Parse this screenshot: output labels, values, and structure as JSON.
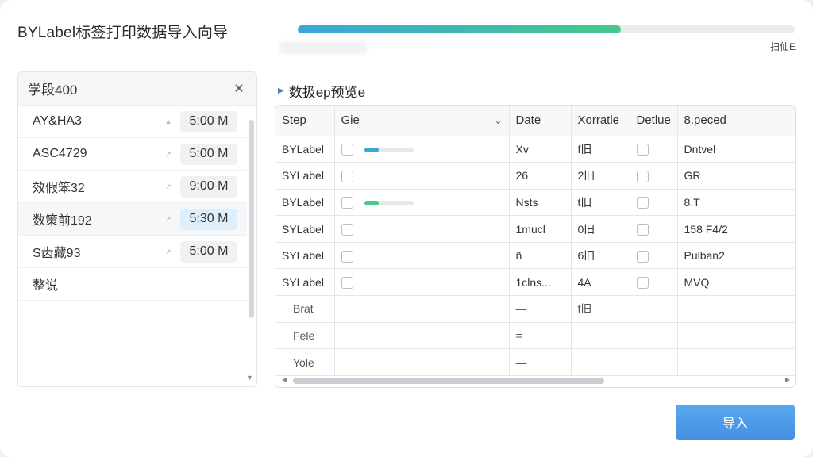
{
  "window": {
    "title": "BYLabel标签打印数据导入向导"
  },
  "progress": {
    "value": 0.65,
    "label": "扫仙E",
    "gradient_start": "#3aa6d8",
    "gradient_end": "#45c98a"
  },
  "list": {
    "header": "学段400",
    "close_icon": "close-icon",
    "items": [
      {
        "label": "AY&HA3",
        "time": "5:00 M",
        "active": false
      },
      {
        "label": "ASC4729",
        "time": "5:00 M",
        "active": false
      },
      {
        "label": "效假笨32",
        "time": "9:00 M",
        "active": false
      },
      {
        "label": "数策前192",
        "time": "5:30 M",
        "active": true
      },
      {
        "label": "S齿藏93",
        "time": "5:00 M",
        "active": false
      },
      {
        "label": "整说",
        "time": "",
        "active": false
      }
    ]
  },
  "preview": {
    "title": "数扱ep预览e"
  },
  "table": {
    "headers": [
      "Step",
      "Gie",
      "Date",
      "Xorratle",
      "Detlue",
      "8.peced"
    ],
    "rows": [
      {
        "step": "BYLabel",
        "bar": 0.3,
        "bar_color": "#3aa6d8",
        "date": "Xv",
        "xor": "f旧",
        "spec": "Dntvel"
      },
      {
        "step": "SYLabel",
        "bar": 0,
        "bar_color": "",
        "date": "26",
        "xor": "2旧",
        "spec": "GR"
      },
      {
        "step": "BYLabel",
        "bar": 0.3,
        "bar_color": "#45c98a",
        "date": "Nsts",
        "xor": "t旧",
        "spec": "8.T"
      },
      {
        "step": "SYLabel",
        "bar": 0,
        "bar_color": "",
        "date": "1mucl",
        "xor": "0旧",
        "spec": "158 F4/2"
      },
      {
        "step": "SYLabel",
        "bar": 0,
        "bar_color": "",
        "date": "ñ",
        "xor": "6旧",
        "spec": "Pulban2"
      },
      {
        "step": "SYLabel",
        "bar": 0,
        "bar_color": "",
        "date": "1clns...",
        "xor": "4A",
        "spec": "MVQ"
      }
    ],
    "extra_rows": [
      {
        "step": "Brat",
        "date": "—",
        "xor": "f旧"
      },
      {
        "step": "Fele",
        "date": "="
      },
      {
        "step": "Yole",
        "date": "—"
      }
    ]
  },
  "footer": {
    "import_label": "导入"
  }
}
